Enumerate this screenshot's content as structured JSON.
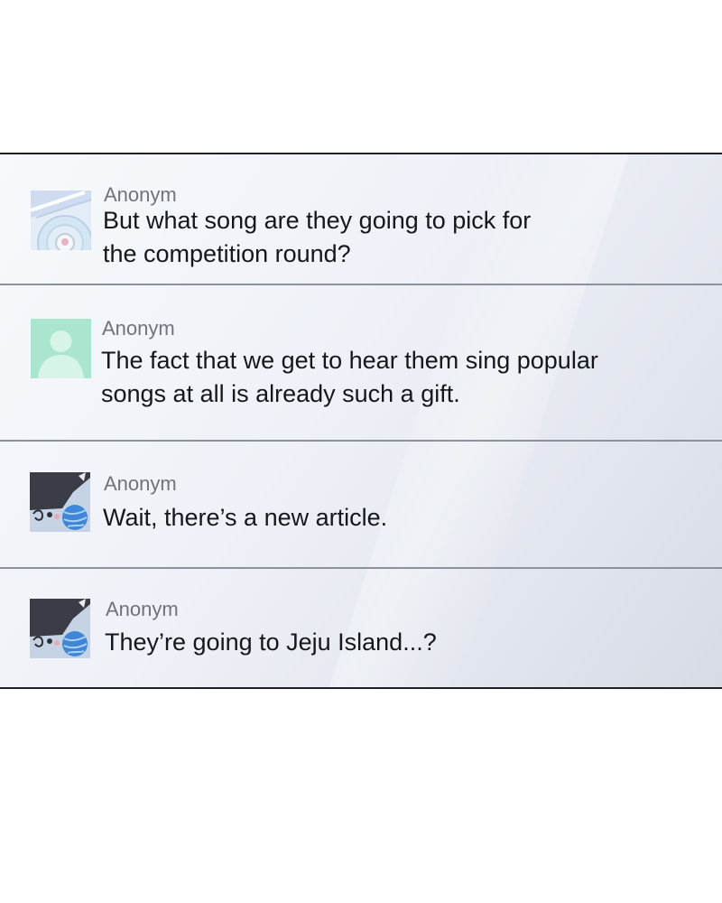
{
  "comments": [
    {
      "author": "Anonym",
      "avatar": "map-badge-avatar-icon",
      "text": "But what song are they going to pick for\nthe competition round?"
    },
    {
      "author": "Anonym",
      "avatar": "default-user-avatar-icon",
      "text": "The fact that we get to hear them sing popular\nsongs at all is already such a gift."
    },
    {
      "author": "Anonym",
      "avatar": "cat-yarn-avatar-icon",
      "text": "Wait, there’s a new article."
    },
    {
      "author": "Anonym",
      "avatar": "cat-yarn-avatar-icon",
      "text": "They’re going to Jeju Island...?"
    }
  ],
  "colors": {
    "border": "#1f1f24",
    "divider": "#8c929c",
    "author_text": "#6f737a",
    "message_text": "#16171b",
    "default_avatar": "#a9e6cd"
  }
}
